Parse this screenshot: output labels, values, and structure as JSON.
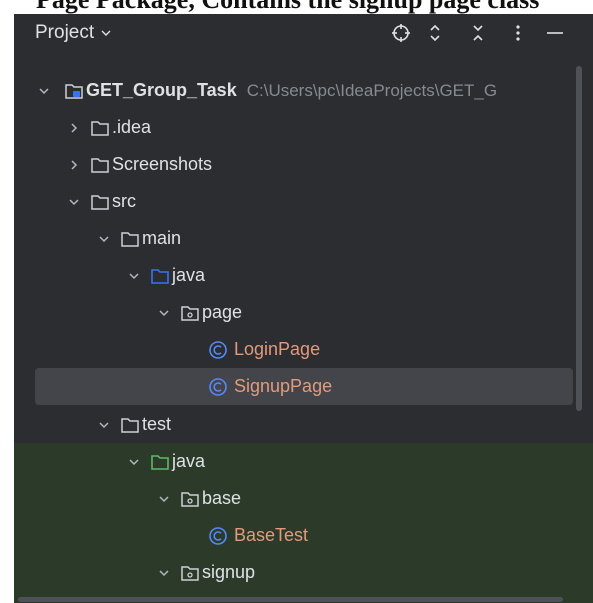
{
  "document_fragment": "Page Package, Contains the signup page class",
  "header": {
    "title": "Project",
    "tools": [
      {
        "icon": "crosshair-icon"
      },
      {
        "icon": "expand-all-icon"
      },
      {
        "icon": "collapse-all-icon"
      },
      {
        "icon": "more-icon"
      },
      {
        "icon": "minimize-icon"
      }
    ]
  },
  "tree": {
    "root": {
      "label": "GET_Group_Task",
      "path": "C:\\Users\\pc\\IdeaProjects\\GET_G"
    },
    "idea": {
      "label": ".idea"
    },
    "screenshots": {
      "label": "Screenshots"
    },
    "src": {
      "label": "src"
    },
    "main": {
      "label": "main"
    },
    "main_java": {
      "label": "java"
    },
    "page": {
      "label": "page"
    },
    "login_page": {
      "label": "LoginPage"
    },
    "signup_page": {
      "label": "SignupPage"
    },
    "test": {
      "label": "test"
    },
    "test_java": {
      "label": "java"
    },
    "base": {
      "label": "base"
    },
    "base_test": {
      "label": "BaseTest"
    },
    "signup": {
      "label": "signup"
    }
  },
  "colors": {
    "panel_bg": "#2b2d30",
    "selected_row": "#43454a",
    "test_zone": "#2c3a2a",
    "class_name": "#e39a7b",
    "class_icon": "#548af7",
    "source_folder": "#3574f0",
    "test_folder": "#5fb865"
  }
}
